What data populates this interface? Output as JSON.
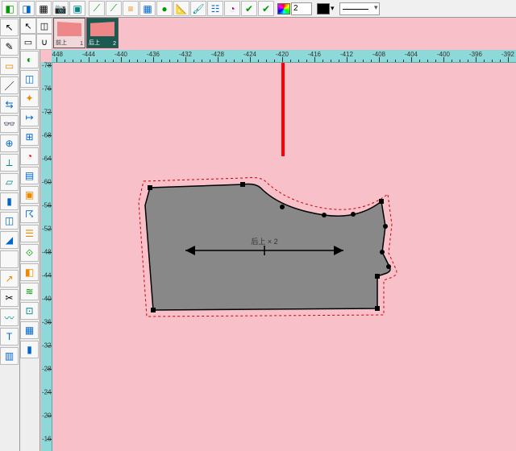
{
  "top_toolbar": {
    "value_input": "2",
    "fill_color": "#000000",
    "stroke_color": "#000000"
  },
  "pieces": [
    {
      "label": "前上",
      "index": "1",
      "active": false
    },
    {
      "label": "后上",
      "index": "2",
      "active": true
    }
  ],
  "ruler_h": [
    "-448",
    "-444",
    "-440",
    "-436",
    "-432",
    "-428",
    "-424",
    "-420",
    "-416",
    "-412",
    "-408",
    "-404",
    "-400",
    "-396",
    "-392"
  ],
  "ruler_v": [
    "-78",
    "-76",
    "-72",
    "-68",
    "-64",
    "-60",
    "-56",
    "-52",
    "-48",
    "-44",
    "-40",
    "-36",
    "-32",
    "-28",
    "-24",
    "-20",
    "-16"
  ],
  "pattern": {
    "center_label": "后上 × 2"
  }
}
